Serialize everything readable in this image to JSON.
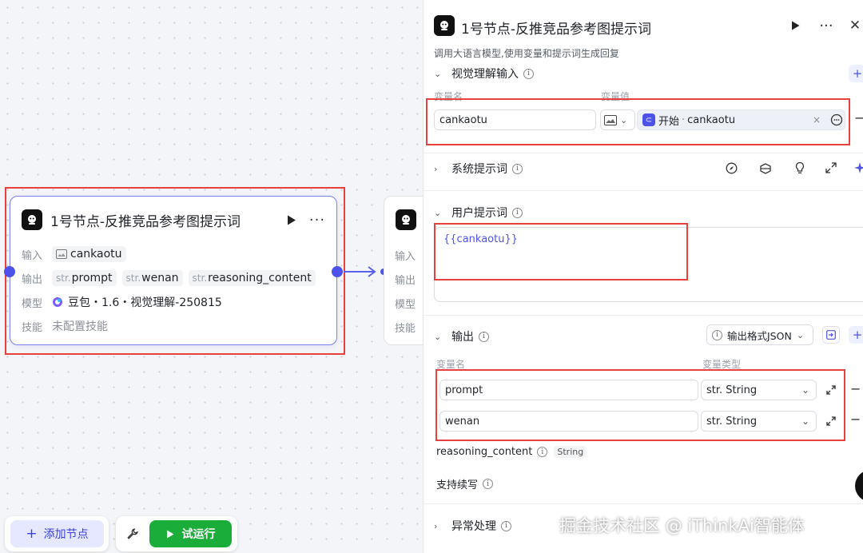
{
  "node": {
    "title": "1号节点-反推竞品参考图提示词",
    "input_label": "输入",
    "input_value": "cankaotu",
    "output_label": "输出",
    "outputs": [
      {
        "prefix": "str.",
        "name": "prompt"
      },
      {
        "prefix": "str.",
        "name": "wenan"
      },
      {
        "prefix": "str.",
        "name": "reasoning_content"
      }
    ],
    "model_label": "模型",
    "model_value": "豆包・1.6・视觉理解-250815",
    "skill_label": "技能",
    "skill_value": "未配置技能"
  },
  "node2": {
    "labels": [
      "输入",
      "输出",
      "模型",
      "技能"
    ]
  },
  "toolbar": {
    "add_node_label": "添加节点",
    "run_label": "试运行"
  },
  "panel": {
    "title": "1号节点-反推竞品参考图提示词",
    "description": "调用大语言模型,使用变量和提示词生成回复",
    "vision_input": {
      "title": "视觉理解输入",
      "col_name": "变量名",
      "col_value": "变量值",
      "var_name": "cankaotu",
      "ref_source": "开始",
      "ref_dot": "·",
      "ref_var": "cankaotu"
    },
    "system_prompt": {
      "title": "系统提示词"
    },
    "user_prompt": {
      "title": "用户提示词",
      "content": "{{cankaotu}}"
    },
    "output": {
      "title": "输出",
      "format_label": "输出格式JSON",
      "col_name": "变量名",
      "col_type": "变量类型",
      "vars": [
        {
          "name": "prompt",
          "type": "str. String"
        },
        {
          "name": "wenan",
          "type": "str. String"
        }
      ],
      "reasoning_name": "reasoning_content",
      "reasoning_type": "String",
      "continue_label": "支持续写"
    },
    "exception": {
      "title": "异常处理"
    }
  },
  "watermark": "掘金技术社区 @ iThinkAi智能体",
  "colors": {
    "accent": "#4d53e8",
    "highlight_red": "#e8413d",
    "run_green": "#1aad3a"
  }
}
